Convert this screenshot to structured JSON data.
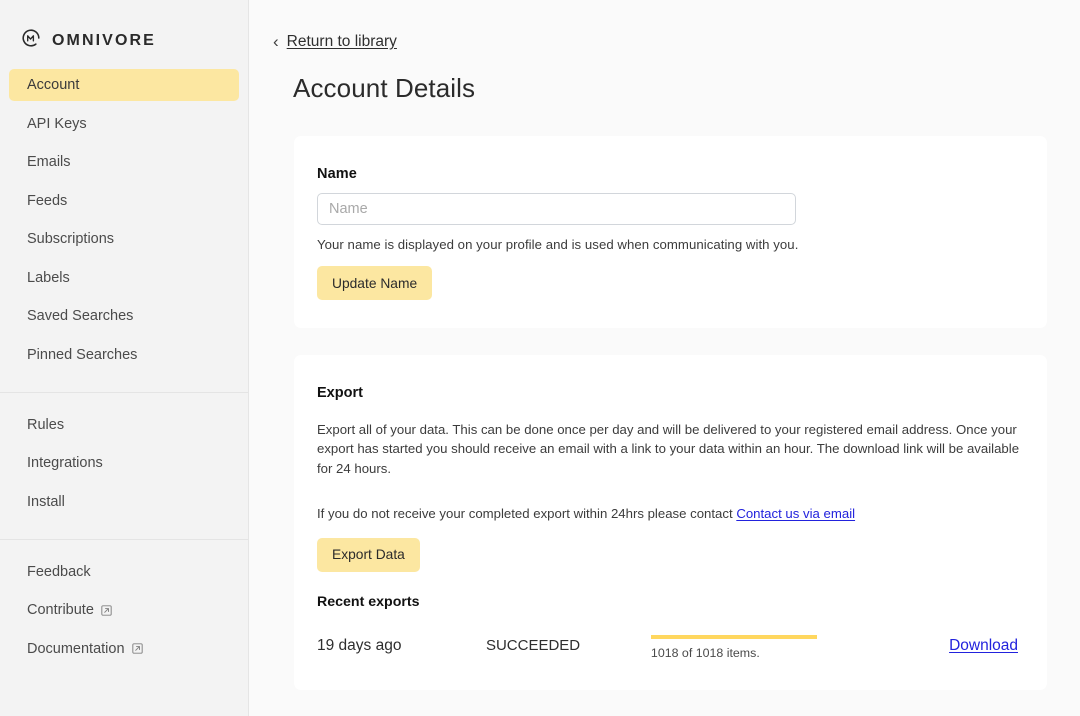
{
  "brand": {
    "name": "OMNIVORE",
    "logo_icon": "omnivore-circle-m-logo"
  },
  "sidebar": {
    "groups": [
      {
        "items": [
          {
            "label": "Account",
            "active": true,
            "external": false
          },
          {
            "label": "API Keys",
            "active": false,
            "external": false
          },
          {
            "label": "Emails",
            "active": false,
            "external": false
          },
          {
            "label": "Feeds",
            "active": false,
            "external": false
          },
          {
            "label": "Subscriptions",
            "active": false,
            "external": false
          },
          {
            "label": "Labels",
            "active": false,
            "external": false
          },
          {
            "label": "Saved Searches",
            "active": false,
            "external": false
          },
          {
            "label": "Pinned Searches",
            "active": false,
            "external": false
          }
        ]
      },
      {
        "items": [
          {
            "label": "Rules",
            "active": false,
            "external": false
          },
          {
            "label": "Integrations",
            "active": false,
            "external": false
          },
          {
            "label": "Install",
            "active": false,
            "external": false
          }
        ]
      },
      {
        "items": [
          {
            "label": "Feedback",
            "active": false,
            "external": false
          },
          {
            "label": "Contribute",
            "active": false,
            "external": true
          },
          {
            "label": "Documentation",
            "active": false,
            "external": true
          }
        ]
      }
    ]
  },
  "header": {
    "back_chevron": "chevron-left-icon",
    "return_label": "Return to library",
    "page_title": "Account Details"
  },
  "name_card": {
    "label": "Name",
    "input_value": "",
    "input_placeholder": "Name",
    "helper": "Your name is displayed on your profile and is used when communicating with you.",
    "button_label": "Update Name"
  },
  "export_card": {
    "title": "Export",
    "description": "Export all of your data. This can be done once per day and will be delivered to your registered email address. Once your export has started you should receive an email with a link to your data within an hour. The download link will be available for 24 hours.",
    "contact_prefix": "If you do not receive your completed export within 24hrs please contact ",
    "contact_link": "Contact us via email",
    "button_label": "Export Data",
    "recent_title": "Recent exports",
    "rows": [
      {
        "date": "19 days ago",
        "status": "SUCCEEDED",
        "progress_percent": 100,
        "progress_caption": "1018 of 1018 items.",
        "download_label": "Download"
      }
    ]
  },
  "colors": {
    "accent_yellow": "#fce7a1",
    "progress_yellow": "#ffd75e",
    "link_blue": "#2222dd",
    "sidebar_bg": "#f3f3f3",
    "page_bg": "#fafafa",
    "card_bg": "#ffffff"
  }
}
